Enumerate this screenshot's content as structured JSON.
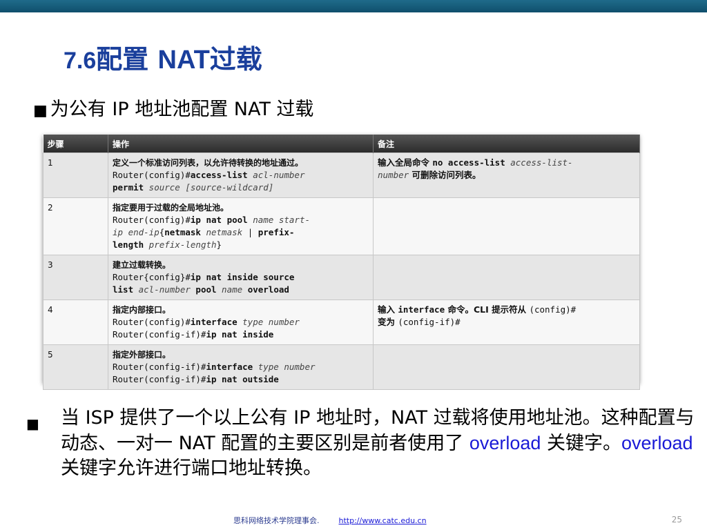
{
  "title": {
    "num": "7.6",
    "cn": "配置 ",
    "nat": "NAT",
    "cn2": "过载"
  },
  "subtitle": {
    "bullet": "■",
    "text": "为公有 IP 地址池配置 NAT 过载"
  },
  "table": {
    "headers": [
      "步骤",
      "操作",
      "备注"
    ],
    "rows": [
      {
        "step": "1",
        "desc": "定义一个标准访问列表，以允许待转换的地址通过。",
        "cmd": [
          [
            {
              "t": "Router(config)#",
              "s": "n"
            },
            {
              "t": "access-list",
              "s": "b"
            },
            {
              "t": " acl-number",
              "s": "i"
            }
          ],
          [
            {
              "t": "permit",
              "s": "b"
            },
            {
              "t": " source [source-wildcard]",
              "s": "i"
            }
          ]
        ],
        "note": [
          [
            {
              "t": "输入全局命令 ",
              "s": "c"
            },
            {
              "t": "no access-list",
              "s": "b"
            },
            {
              "t": " access-list-",
              "s": "i"
            }
          ],
          [
            {
              "t": "number",
              "s": "i"
            },
            {
              "t": " 可删除访问列表。",
              "s": "c"
            }
          ]
        ]
      },
      {
        "step": "2",
        "desc": "指定要用于过载的全局地址池。",
        "cmd": [
          [
            {
              "t": "Router(config)#",
              "s": "n"
            },
            {
              "t": "ip nat pool",
              "s": "b"
            },
            {
              "t": " name start-",
              "s": "i"
            }
          ],
          [
            {
              "t": "ip end-ip",
              "s": "i"
            },
            {
              "t": "{",
              "s": "n"
            },
            {
              "t": "netmask",
              "s": "b"
            },
            {
              "t": " netmask",
              "s": "i"
            },
            {
              "t": " | ",
              "s": "n"
            },
            {
              "t": "prefix-",
              "s": "b"
            }
          ],
          [
            {
              "t": "length",
              "s": "b"
            },
            {
              "t": " prefix-length",
              "s": "i"
            },
            {
              "t": "}",
              "s": "n"
            }
          ]
        ],
        "note": []
      },
      {
        "step": "3",
        "desc": "建立过载转换。",
        "cmd": [
          [
            {
              "t": "Router{config}#",
              "s": "n"
            },
            {
              "t": "ip nat inside source",
              "s": "b"
            }
          ],
          [
            {
              "t": "list",
              "s": "b"
            },
            {
              "t": " acl-number ",
              "s": "i"
            },
            {
              "t": " pool",
              "s": "b"
            },
            {
              "t": " name",
              "s": "i"
            },
            {
              "t": " overload",
              "s": "b"
            }
          ]
        ],
        "note": []
      },
      {
        "step": "4",
        "desc": "指定内部接口。",
        "cmd": [
          [
            {
              "t": "Router(config)#",
              "s": "n"
            },
            {
              "t": "interface",
              "s": "b"
            },
            {
              "t": " type number",
              "s": "i"
            }
          ],
          [
            {
              "t": "Router(config-if)#",
              "s": "n"
            },
            {
              "t": "ip nat inside",
              "s": "b"
            }
          ]
        ],
        "note": [
          [
            {
              "t": "输入 ",
              "s": "c"
            },
            {
              "t": "interface",
              "s": "b"
            },
            {
              "t": " 命令。CLI 提示符从 ",
              "s": "c"
            },
            {
              "t": "(config)#",
              "s": "n"
            }
          ],
          [
            {
              "t": "变为 ",
              "s": "c"
            },
            {
              "t": "(config-if)#",
              "s": "n"
            }
          ]
        ]
      },
      {
        "step": "5",
        "desc": "指定外部接口。",
        "cmd": [
          [
            {
              "t": "Router(config-if)#",
              "s": "n"
            },
            {
              "t": "interface",
              "s": "b"
            },
            {
              "t": " type number",
              "s": "i"
            }
          ],
          [
            {
              "t": "Router(config-if)#",
              "s": "n"
            },
            {
              "t": "ip nat  outside",
              "s": "b"
            }
          ]
        ],
        "note": []
      }
    ]
  },
  "body": {
    "bullet": "■",
    "part1": "当 ISP 提供了一个以上公有 IP 地址时，NAT 过载将使用地址池。这种配置与动态、一对一 NAT 配置的主要区别是前者使用了 ",
    "kw1": "overload",
    "part2": " 关键字。",
    "kw2": "overload",
    "part3": " 关键字允许进行端口地址转换。"
  },
  "footer": {
    "org": "思科网络技术学院理事会.",
    "url": "http://www.catc.edu.cn"
  },
  "page_number": "25"
}
